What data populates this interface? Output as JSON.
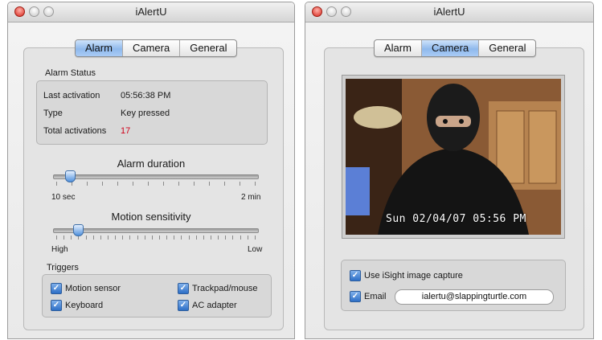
{
  "windows": [
    {
      "title": "iAlertU",
      "tabs": [
        {
          "label": "Alarm",
          "active": true
        },
        {
          "label": "Camera",
          "active": false
        },
        {
          "label": "General",
          "active": false
        }
      ],
      "alarm_status": {
        "title": "Alarm Status",
        "rows": [
          {
            "label": "Last activation",
            "value": "05:56:38 PM"
          },
          {
            "label": "Type",
            "value": "Key pressed"
          },
          {
            "label": "Total activations",
            "value": "17"
          }
        ]
      },
      "alarm_duration": {
        "title": "Alarm duration",
        "min_label": "10 sec",
        "max_label": "2 min",
        "position_fraction": 0.06
      },
      "motion_sensitivity": {
        "title": "Motion sensitivity",
        "min_label": "High",
        "max_label": "Low",
        "position_fraction": 0.1
      },
      "triggers": {
        "title": "Triggers",
        "items": [
          {
            "label": "Motion sensor",
            "checked": true
          },
          {
            "label": "Trackpad/mouse",
            "checked": true
          },
          {
            "label": "Keyboard",
            "checked": true
          },
          {
            "label": "AC adapter",
            "checked": true
          }
        ]
      }
    },
    {
      "title": "iAlertU",
      "tabs": [
        {
          "label": "Alarm",
          "active": false
        },
        {
          "label": "Camera",
          "active": true
        },
        {
          "label": "General",
          "active": false
        }
      ],
      "camera": {
        "timestamp": "Sun 02/04/07 05:56 PM",
        "use_isight_label": "Use iSight image capture",
        "use_isight_checked": true,
        "email_label": "Email",
        "email_checked": true,
        "email_value": "ialertu@slappingturtle.com"
      }
    }
  ],
  "colors": {
    "accent_blue": "#8fb9ec",
    "activation_count": "#d0021b"
  }
}
